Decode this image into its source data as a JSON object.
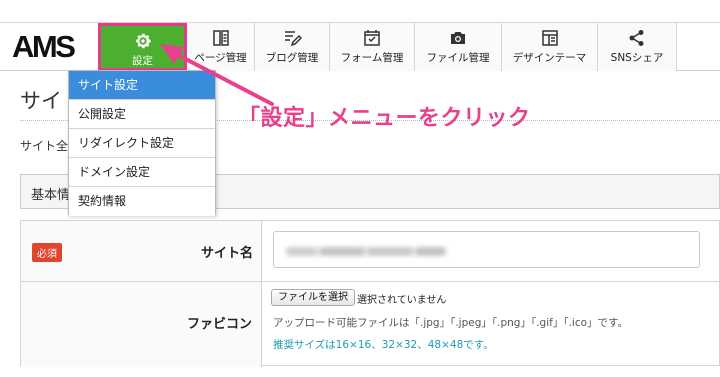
{
  "app": {
    "logo_text": "AMS"
  },
  "nav": {
    "items": [
      {
        "label": "設定",
        "icon": "gear-icon"
      },
      {
        "label": "ページ管理",
        "icon": "pages-icon"
      },
      {
        "label": "ブログ管理",
        "icon": "blog-edit-icon"
      },
      {
        "label": "フォーム管理",
        "icon": "form-check-icon"
      },
      {
        "label": "ファイル管理",
        "icon": "camera-icon"
      },
      {
        "label": "デザインテーマ",
        "icon": "layout-icon"
      },
      {
        "label": "SNSシェア",
        "icon": "share-icon"
      }
    ]
  },
  "dropdown": {
    "items": [
      {
        "label": "サイト設定",
        "active": true
      },
      {
        "label": "公開設定"
      },
      {
        "label": "リダイレクト設定"
      },
      {
        "label": "ドメイン設定"
      },
      {
        "label": "契約情報"
      }
    ]
  },
  "main": {
    "title": "サイ",
    "subtitle": "サイト全",
    "tab": "基本情"
  },
  "form": {
    "site_name": {
      "required_badge": "必須",
      "label": "サイト名"
    },
    "favicon": {
      "label": "ファビコン",
      "button": "ファイルを選択",
      "status": "選択されていません",
      "help": "アップロード可能ファイルは「.jpg」「.jpeg」「.png」「.gif」「.ico」です。",
      "size_note": "推奨サイズは16×16、32×32、48×48です。"
    }
  },
  "annotation": {
    "text": "「設定」メニューをクリック"
  },
  "colors": {
    "settings_green": "#4caf2f",
    "highlight_pink": "#e83a8a",
    "menu_active_blue": "#3a8ddd",
    "required_red": "#e2452f",
    "note_teal": "#1c9ab4"
  }
}
